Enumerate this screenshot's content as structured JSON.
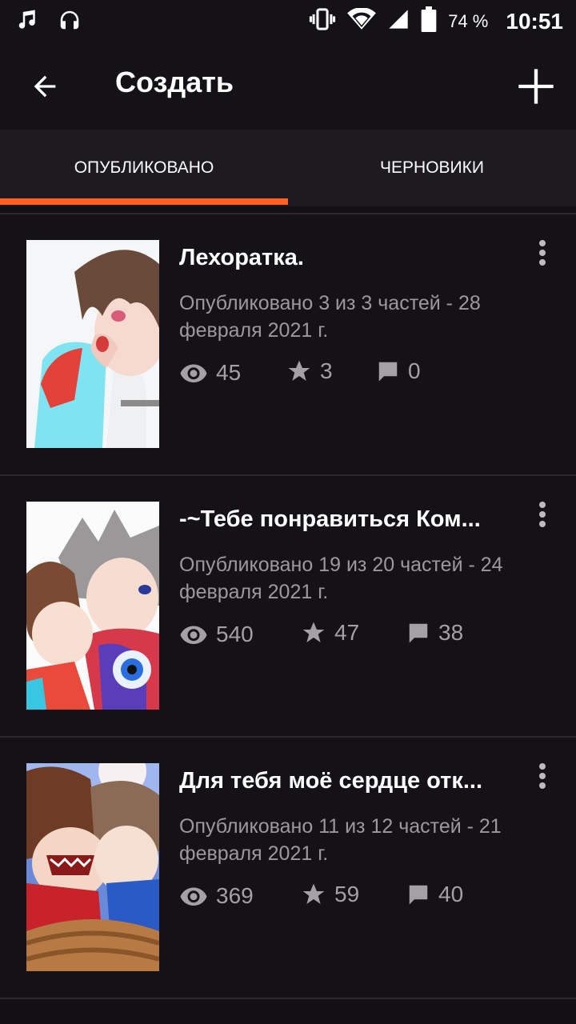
{
  "status_bar": {
    "battery": "74 %",
    "time": "10:51",
    "icons": [
      "music-note-icon",
      "headset-icon",
      "vibrate-icon",
      "wifi-icon",
      "signal-icon",
      "battery-icon"
    ]
  },
  "app_bar": {
    "title": "Создать",
    "back_icon": "arrow-back-icon",
    "add_icon": "plus-icon"
  },
  "tabs": [
    {
      "label": "ОПУБЛИКОВАНО",
      "selected": true
    },
    {
      "label": "ЧЕРНОВИКИ",
      "selected": false
    }
  ],
  "accent_color": "#ff6122",
  "stories": [
    {
      "title": "Лехоратка.",
      "meta": "Опубликовано 3 из 3 частей - 28 февраля 2021 г.",
      "views": "45",
      "votes": "3",
      "comments": "0"
    },
    {
      "title": "-~Тебе понравиться Ком...",
      "meta": "Опубликовано 19 из 20 частей - 24 февраля 2021 г.",
      "views": "540",
      "votes": "47",
      "comments": "38"
    },
    {
      "title": "Для тебя моё сердце отк...",
      "meta": "Опубликовано 11 из 12 частей - 21 февраля 2021 г.",
      "views": "369",
      "votes": "59",
      "comments": "40"
    }
  ]
}
